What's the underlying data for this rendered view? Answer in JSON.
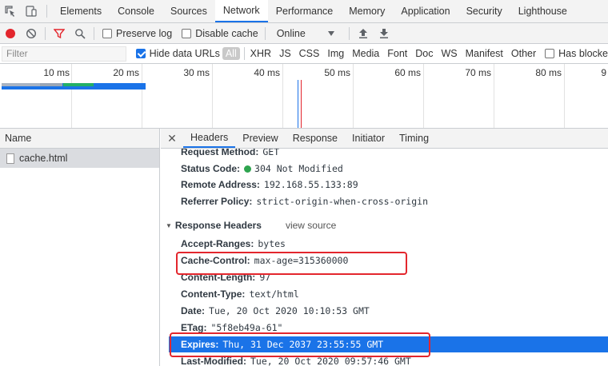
{
  "devtools_tabs": [
    "Elements",
    "Console",
    "Sources",
    "Network",
    "Performance",
    "Memory",
    "Application",
    "Security",
    "Lighthouse"
  ],
  "active_tab": "Network",
  "toolbar": {
    "preserve_log": "Preserve log",
    "disable_cache": "Disable cache",
    "throttle": "Online"
  },
  "filter": {
    "placeholder": "Filter",
    "hide_data_urls": "Hide data URLs",
    "all": "All",
    "types": [
      "XHR",
      "JS",
      "CSS",
      "Img",
      "Media",
      "Font",
      "Doc",
      "WS",
      "Manifest",
      "Other"
    ],
    "has_blocked": "Has blocke"
  },
  "overview": {
    "ticks": [
      "10 ms",
      "20 ms",
      "30 ms",
      "40 ms",
      "50 ms",
      "60 ms",
      "70 ms",
      "80 ms",
      "9"
    ]
  },
  "name_column": {
    "header": "Name",
    "rows": [
      "cache.html"
    ]
  },
  "details": {
    "tabs": [
      "Headers",
      "Preview",
      "Response",
      "Initiator",
      "Timing"
    ],
    "active_tab": "Headers",
    "general": [
      {
        "key": "Request Method:",
        "value": "GET"
      },
      {
        "key": "Status Code:",
        "value": "304 Not Modified"
      },
      {
        "key": "Remote Address:",
        "value": "192.168.55.133:89"
      },
      {
        "key": "Referrer Policy:",
        "value": "strict-origin-when-cross-origin"
      }
    ],
    "response_section": "Response Headers",
    "view_source": "view source",
    "response_headers": [
      {
        "key": "Accept-Ranges:",
        "value": "bytes"
      },
      {
        "key": "Cache-Control:",
        "value": "max-age=315360000"
      },
      {
        "key": "Content-Length:",
        "value": "97"
      },
      {
        "key": "Content-Type:",
        "value": "text/html"
      },
      {
        "key": "Date:",
        "value": "Tue, 20 Oct 2020 10:10:53 GMT"
      },
      {
        "key": "ETag:",
        "value": "\"5f8eb49a-61\""
      },
      {
        "key": "Expires:",
        "value": "Thu, 31 Dec 2037 23:55:55 GMT"
      },
      {
        "key": "Last-Modified:",
        "value": "Tue, 20 Oct 2020 09:57:46 GMT"
      }
    ]
  },
  "colors": {
    "accent": "#1a73e8",
    "highlight_box": "#e3262d",
    "status_ok": "#2ea44f"
  }
}
